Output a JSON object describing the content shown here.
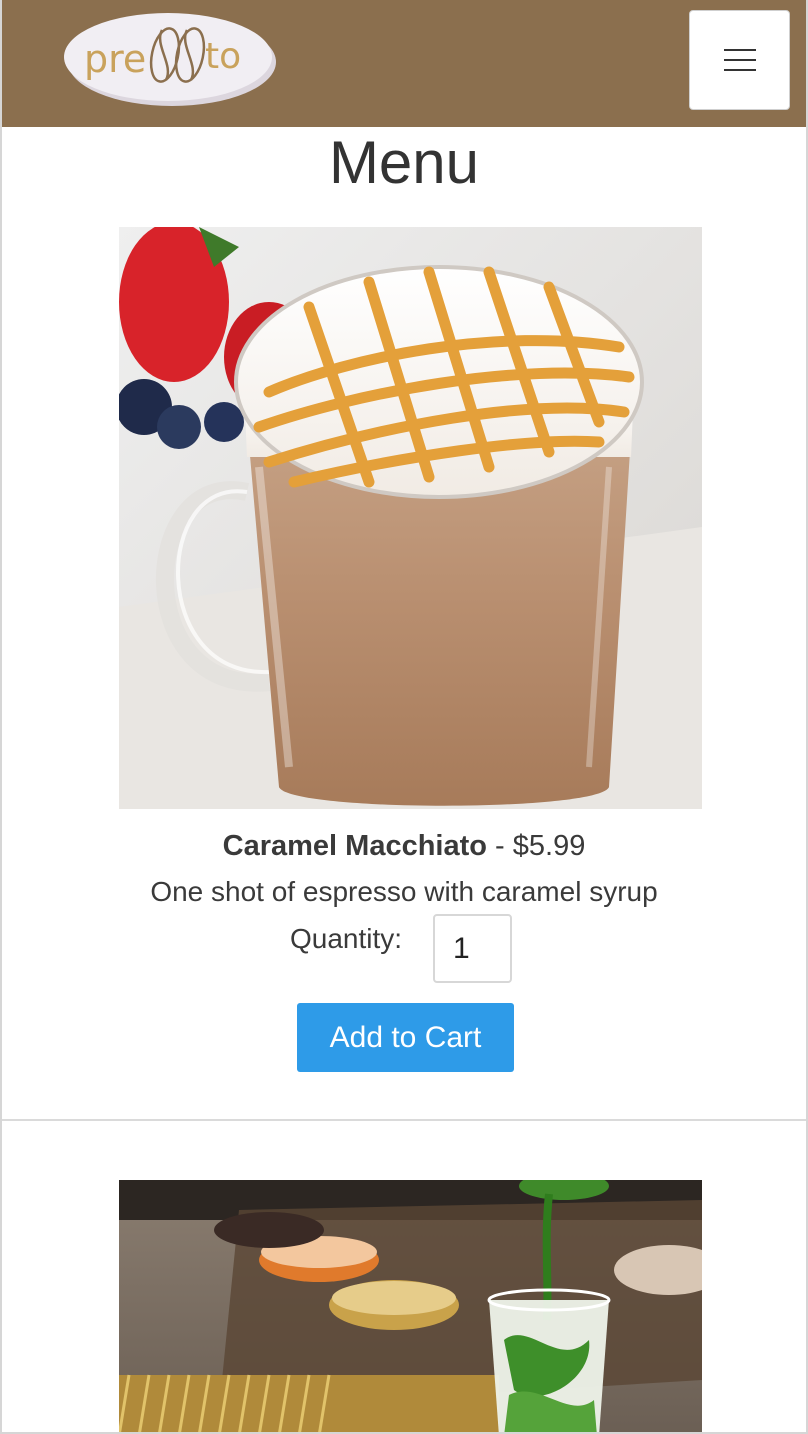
{
  "brand": {
    "logo_text_left": "pre",
    "logo_text_right": "to",
    "logo_icon": "coffee-bean-icon",
    "navbar_color": "#8b6f4e"
  },
  "navbar": {
    "menu_toggle_icon": "hamburger-menu-icon"
  },
  "page_title": "Menu",
  "products": [
    {
      "name": "Caramel Macchiato",
      "separator": " - ",
      "price": "$5.99",
      "description": "One shot of espresso with caramel syrup",
      "quantity_label": "Quantity:",
      "quantity_value": "1",
      "add_button_label": "Add to Cart"
    }
  ],
  "colors": {
    "accent_button": "#2e9be8"
  }
}
